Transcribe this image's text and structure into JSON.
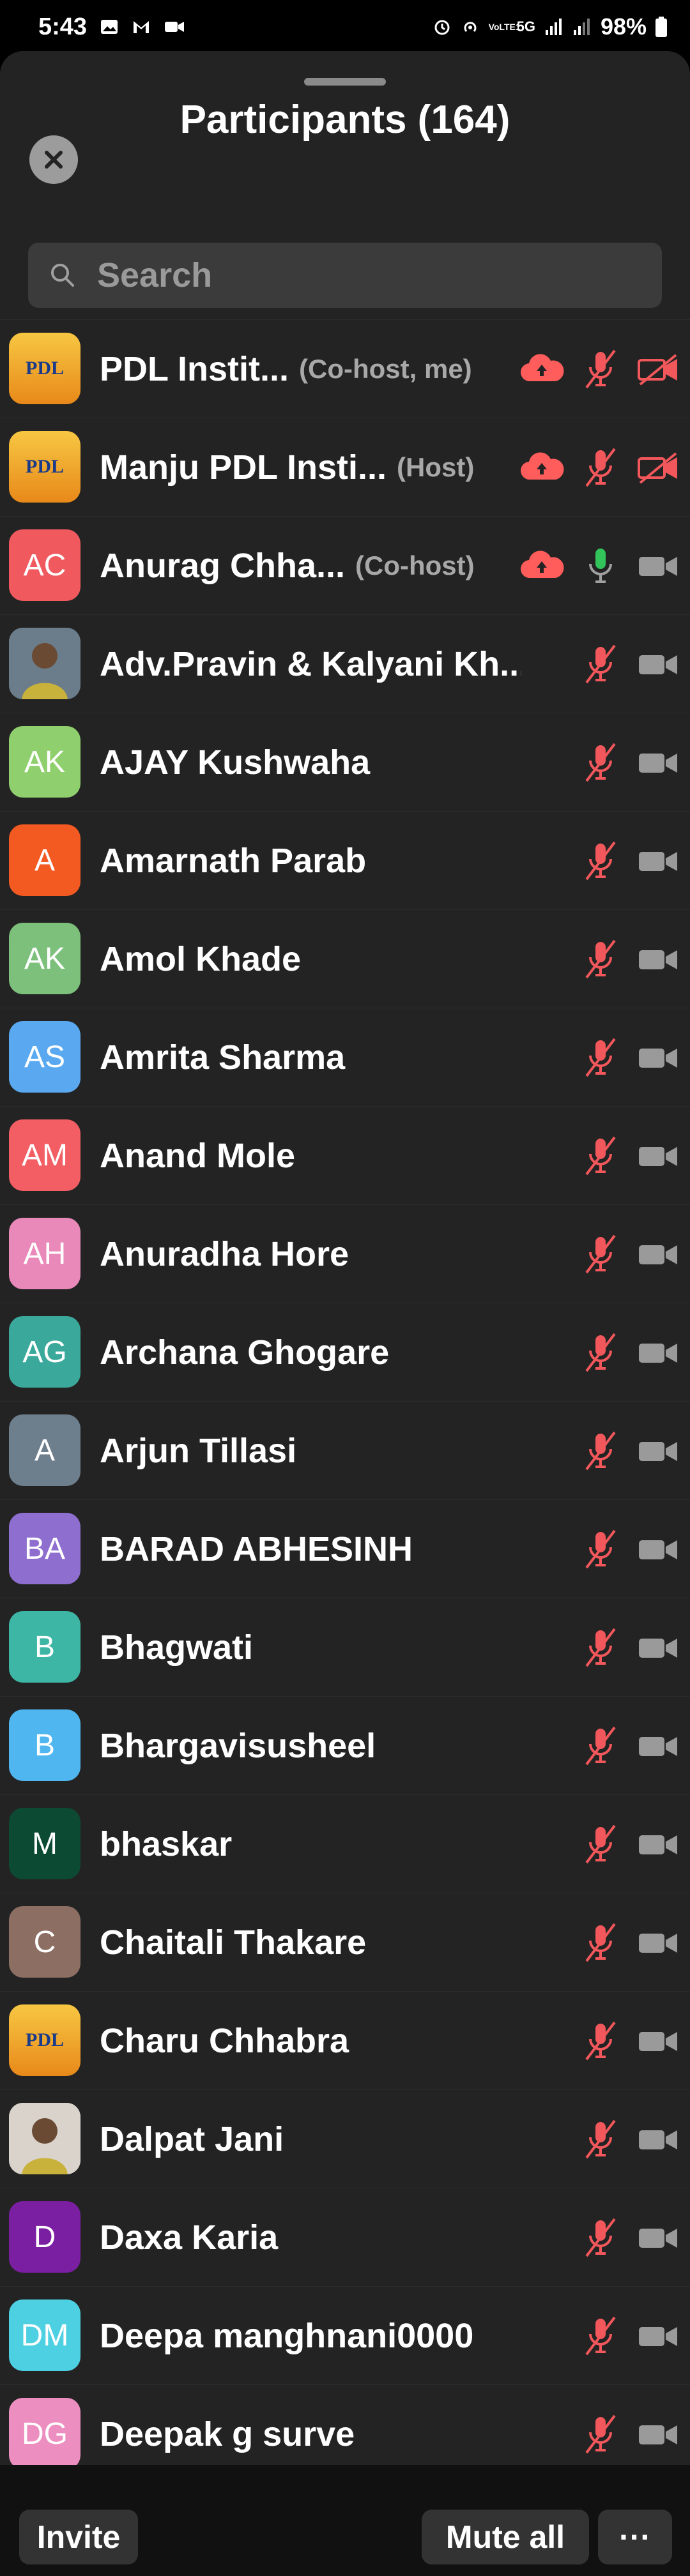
{
  "status_bar": {
    "time": "5:43",
    "battery": "98%",
    "network": "5G",
    "volte": "VoLTE1"
  },
  "header": {
    "title": "Participants (164)"
  },
  "search": {
    "placeholder": "Search"
  },
  "colors": {
    "muted_red": "#f2575b",
    "cloud_red": "#ff5c5c",
    "mic_green": "#32c35a",
    "video_gray": "#9a9a9a"
  },
  "participants": [
    {
      "initials": "PDL",
      "name": "PDL Instit...",
      "role": "(Co-host, me)",
      "avatar_type": "logo",
      "color": "#e58a1a",
      "cloud": true,
      "mic": "muted",
      "video": "off"
    },
    {
      "initials": "PDL",
      "name": "Manju PDL Insti...",
      "role": "(Host)",
      "avatar_type": "logo",
      "color": "#e58a1a",
      "cloud": true,
      "mic": "muted",
      "video": "off"
    },
    {
      "initials": "AC",
      "name": "Anurag Chha...",
      "role": "(Co-host)",
      "avatar_type": "initials",
      "color": "#f05a5f",
      "cloud": true,
      "mic": "on",
      "video": "gray"
    },
    {
      "initials": "",
      "name": "Adv.Pravin & Kalyani Kh...",
      "role": "",
      "avatar_type": "photo",
      "color": "#6b7d8a",
      "cloud": false,
      "mic": "muted",
      "video": "gray"
    },
    {
      "initials": "AK",
      "name": "AJAY Kushwaha",
      "role": "",
      "avatar_type": "initials",
      "color": "#8fcf6e",
      "cloud": false,
      "mic": "muted",
      "video": "gray"
    },
    {
      "initials": "A",
      "name": "Amarnath Parab",
      "role": "",
      "avatar_type": "initials",
      "color": "#f35a22",
      "cloud": false,
      "mic": "muted",
      "video": "gray"
    },
    {
      "initials": "AK",
      "name": "Amol Khade",
      "role": "",
      "avatar_type": "initials",
      "color": "#7cc07c",
      "cloud": false,
      "mic": "muted",
      "video": "gray"
    },
    {
      "initials": "AS",
      "name": "Amrita Sharma",
      "role": "",
      "avatar_type": "initials",
      "color": "#5aa9f0",
      "cloud": false,
      "mic": "muted",
      "video": "gray"
    },
    {
      "initials": "AM",
      "name": "Anand Mole",
      "role": "",
      "avatar_type": "initials",
      "color": "#f25e63",
      "cloud": false,
      "mic": "muted",
      "video": "gray"
    },
    {
      "initials": "AH",
      "name": "Anuradha Hore",
      "role": "",
      "avatar_type": "initials",
      "color": "#e889b9",
      "cloud": false,
      "mic": "muted",
      "video": "gray"
    },
    {
      "initials": "AG",
      "name": "Archana Ghogare",
      "role": "",
      "avatar_type": "initials",
      "color": "#3aa99b",
      "cloud": false,
      "mic": "muted",
      "video": "gray"
    },
    {
      "initials": "A",
      "name": "Arjun Tillasi",
      "role": "",
      "avatar_type": "initials",
      "color": "#6d7e8c",
      "cloud": false,
      "mic": "muted",
      "video": "gray"
    },
    {
      "initials": "BA",
      "name": "BARAD ABHESINH",
      "role": "",
      "avatar_type": "initials",
      "color": "#8e6fcf",
      "cloud": false,
      "mic": "muted",
      "video": "gray"
    },
    {
      "initials": "B",
      "name": "Bhagwati",
      "role": "",
      "avatar_type": "initials",
      "color": "#3db6a6",
      "cloud": false,
      "mic": "muted",
      "video": "gray"
    },
    {
      "initials": "B",
      "name": "Bhargavisusheel",
      "role": "",
      "avatar_type": "initials",
      "color": "#4fb6f0",
      "cloud": false,
      "mic": "muted",
      "video": "gray"
    },
    {
      "initials": "M",
      "name": "bhaskar",
      "role": "",
      "avatar_type": "initials",
      "color": "#0c4a34",
      "cloud": false,
      "mic": "muted",
      "video": "gray"
    },
    {
      "initials": "C",
      "name": "Chaitali Thakare",
      "role": "",
      "avatar_type": "initials",
      "color": "#8d6e63",
      "cloud": false,
      "mic": "muted",
      "video": "gray"
    },
    {
      "initials": "PDL",
      "name": "Charu Chhabra",
      "role": "",
      "avatar_type": "logo",
      "color": "#e58a1a",
      "cloud": false,
      "mic": "muted",
      "video": "gray"
    },
    {
      "initials": "",
      "name": "Dalpat Jani",
      "role": "",
      "avatar_type": "photo",
      "color": "#d9d3cc",
      "cloud": false,
      "mic": "muted",
      "video": "gray"
    },
    {
      "initials": "D",
      "name": "Daxa Karia",
      "role": "",
      "avatar_type": "initials",
      "color": "#7b1fa2",
      "cloud": false,
      "mic": "muted",
      "video": "gray"
    },
    {
      "initials": "DM",
      "name": "Deepa manghnani0000",
      "role": "",
      "avatar_type": "initials",
      "color": "#4dd0e1",
      "cloud": false,
      "mic": "muted",
      "video": "gray"
    },
    {
      "initials": "DG",
      "name": "Deepak g surve",
      "role": "",
      "avatar_type": "initials",
      "color": "#ec8ec0",
      "cloud": false,
      "mic": "muted",
      "video": "gray"
    }
  ],
  "footer": {
    "invite_label": "Invite",
    "mute_all_label": "Mute all",
    "more_label": "···"
  }
}
